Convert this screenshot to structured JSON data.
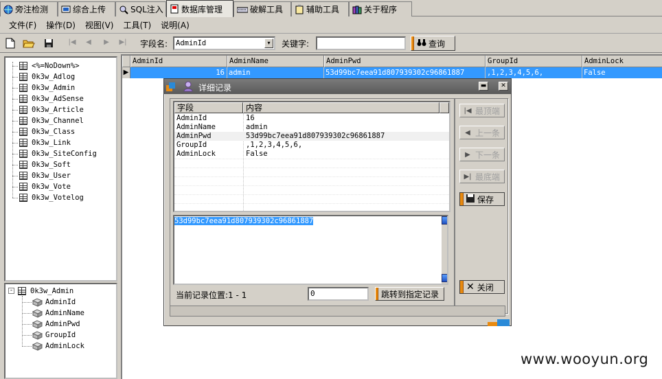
{
  "tabs": [
    {
      "label": "旁注检测",
      "icon": "globe-icon"
    },
    {
      "label": "综合上传",
      "icon": "monitor-icon"
    },
    {
      "label": "SQL注入",
      "icon": "magnifier-icon"
    },
    {
      "label": "数据库管理",
      "icon": "database-icon"
    },
    {
      "label": "破解工具",
      "icon": "keyboard-icon"
    },
    {
      "label": "辅助工具",
      "icon": "clipboard-icon"
    },
    {
      "label": "关于程序",
      "icon": "books-icon"
    }
  ],
  "menu": [
    "文件(F)",
    "操作(D)",
    "视图(V)",
    "工具(T)",
    "说明(A)"
  ],
  "toolbar": {
    "field_label": "字段名:",
    "field_value": "AdminId",
    "keyword_label": "关键字:",
    "keyword_value": "",
    "query_label": "查询"
  },
  "tables": [
    "<%=NoDown%>",
    "0k3w_Adlog",
    "0k3w_Admin",
    "0k3w_AdSense",
    "0k3w_Article",
    "0k3w_Channel",
    "0k3w_Class",
    "0k3w_Link",
    "0k3w_SiteConfig",
    "0k3w_Soft",
    "0k3w_User",
    "0k3w_Vote",
    "0k3w_Votelog"
  ],
  "columns_tree": {
    "table": "0k3w_Admin",
    "columns": [
      "AdminId",
      "AdminName",
      "AdminPwd",
      "GroupId",
      "AdminLock"
    ]
  },
  "grid": {
    "headers": [
      "AdminId",
      "AdminName",
      "AdminPwd",
      "GroupId",
      "AdminLock"
    ],
    "row": [
      "16",
      "admin",
      "53d99bc7eea91d807939302c96861887",
      ",1,2,3,4,5,6,",
      "False"
    ]
  },
  "dialog": {
    "title": "详细记录",
    "list_headers": [
      "字段",
      "内容"
    ],
    "rows": [
      {
        "field": "AdminId",
        "value": "16"
      },
      {
        "field": "AdminName",
        "value": "admin"
      },
      {
        "field": "AdminPwd",
        "value": "53d99bc7eea91d807939302c96861887"
      },
      {
        "field": "GroupId",
        "value": ",1,2,3,4,5,6,"
      },
      {
        "field": "AdminLock",
        "value": "False"
      }
    ],
    "selected_value": "53d99bc7eea91d807939302c96861887",
    "nav_buttons": {
      "first": "最顶端",
      "prev": "上一条",
      "next": "下一条",
      "last": "最底端"
    },
    "save_label": "保存",
    "close_label": "关闭",
    "position_label": "当前记录位置:1 - 1",
    "jump_value": "0",
    "jump_label": "跳转到指定记录"
  },
  "watermark": "www.wooyun.org",
  "colors": {
    "selection": "#3399ff",
    "accent": "#e88a10",
    "title_bar": "#6a6a6a"
  }
}
